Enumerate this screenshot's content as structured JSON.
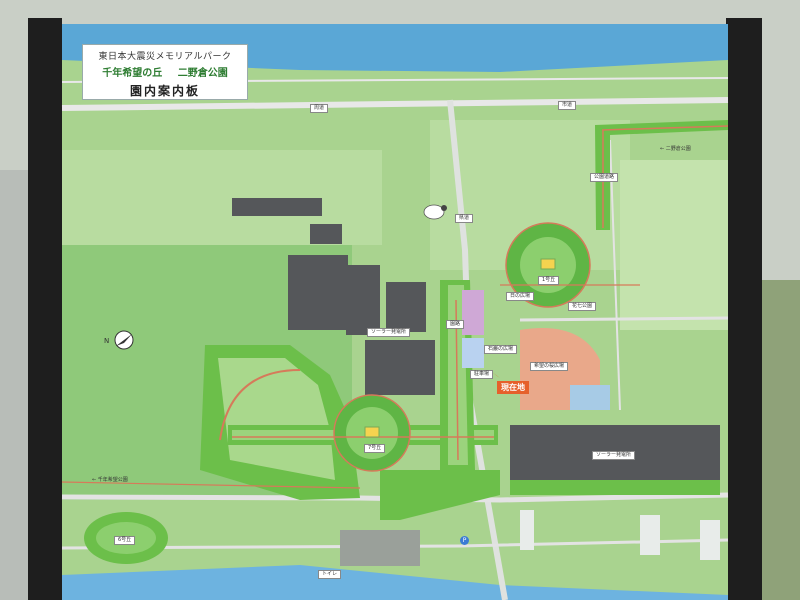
{
  "board": {
    "title_line1": "東日本大震災メモリアルパーク",
    "park_name_1": "千年希望の丘",
    "park_name_2": "二野倉公園",
    "title_line3": "園内案内板"
  },
  "labels": {
    "you_are_here": "現在地",
    "loop_hill_1": "1号丘",
    "loop_hill_7": "7号丘",
    "plaza_1": "日の広場",
    "plaza_2": "花七公園",
    "plaza_3": "石巌の広場",
    "plaza_4": "希望の桜広場",
    "parking": "駐車場",
    "solar_1": "ソーラー発電所",
    "solar_2": "ソーラー発電所",
    "entrance": "園路",
    "road_1": "周道",
    "road_2": "市道",
    "road_3": "県道",
    "park_road": "公園道路",
    "hill_6": "6号丘",
    "to_park_right": "← 二野倉公園",
    "to_park_left": "← 千年希望公園",
    "toilet": "トイレ",
    "parking_symbol": "P",
    "compass": "N"
  },
  "colors": {
    "sea": "#5aa7d6",
    "land": "#a9d38f",
    "park_green": "#6cbf4a",
    "path": "#d67a5a",
    "solar": "#55575a",
    "here_marker": "#e6602b"
  }
}
